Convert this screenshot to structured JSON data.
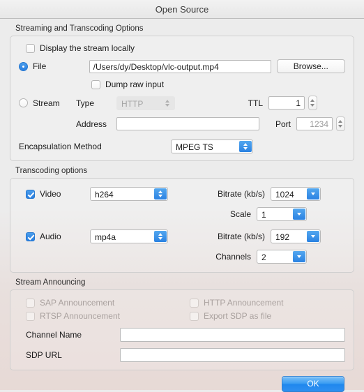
{
  "window": {
    "title": "Open Source"
  },
  "streaming_section": {
    "title": "Streaming and Transcoding Options",
    "display_locally": {
      "label": "Display the stream locally",
      "checked": false
    },
    "file": {
      "radio_label": "File",
      "selected": true,
      "path_value": "/Users/dy/Desktop/vlc-output.mp4",
      "browse_label": "Browse..."
    },
    "dump_raw_input": {
      "label": "Dump raw input",
      "checked": false
    },
    "stream": {
      "radio_label": "Stream",
      "selected": false,
      "type_label": "Type",
      "type_value": "HTTP",
      "type_enabled": false,
      "address_label": "Address",
      "address_value": "",
      "ttl_label": "TTL",
      "ttl_value": "1",
      "port_label": "Port",
      "port_value": "1234"
    },
    "encapsulation": {
      "label": "Encapsulation Method",
      "value": "MPEG TS"
    }
  },
  "transcoding_section": {
    "title": "Transcoding options",
    "video": {
      "label": "Video",
      "checked": true,
      "codec": "h264",
      "bitrate_label": "Bitrate (kb/s)",
      "bitrate_value": "1024",
      "scale_label": "Scale",
      "scale_value": "1"
    },
    "audio": {
      "label": "Audio",
      "checked": true,
      "codec": "mp4a",
      "bitrate_label": "Bitrate (kb/s)",
      "bitrate_value": "192",
      "channels_label": "Channels",
      "channels_value": "2"
    }
  },
  "announcing_section": {
    "title": "Stream Announcing",
    "sap": {
      "label": "SAP Announcement",
      "checked": false
    },
    "http": {
      "label": "HTTP Announcement",
      "checked": false
    },
    "rtsp": {
      "label": "RTSP Announcement",
      "checked": false
    },
    "export_sdp": {
      "label": "Export SDP as file",
      "checked": false
    },
    "channel_name_label": "Channel Name",
    "channel_name_value": "",
    "sdp_url_label": "SDP URL",
    "sdp_url_value": ""
  },
  "footer": {
    "ok_label": "OK"
  },
  "colors": {
    "accent_blue": "#2b82e2",
    "window_bg": "#ececec",
    "disabled_text": "#a9a19e"
  }
}
